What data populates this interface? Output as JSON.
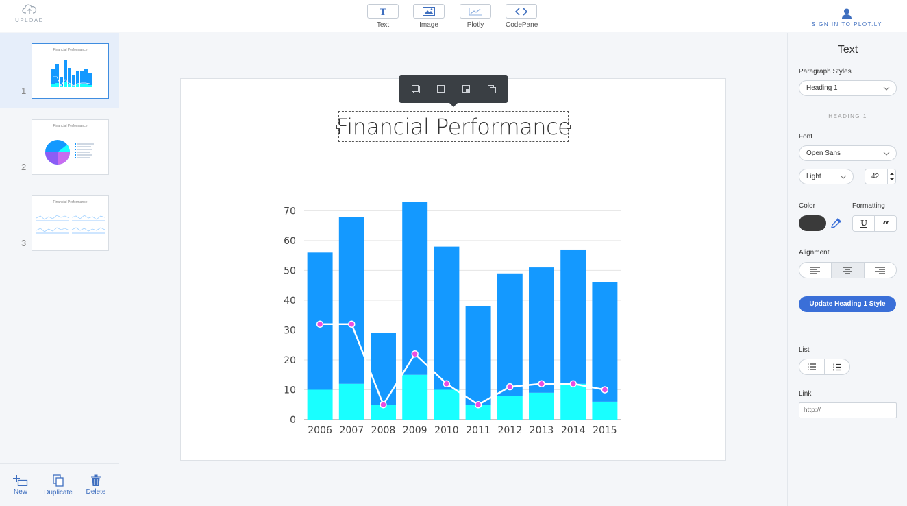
{
  "topbar": {
    "upload_label": "UPLOAD",
    "tools": [
      {
        "label": "Text",
        "icon": "text-icon"
      },
      {
        "label": "Image",
        "icon": "image-icon"
      },
      {
        "label": "Plotly",
        "icon": "plotly-chart-icon"
      },
      {
        "label": "CodePane",
        "icon": "code-icon"
      }
    ],
    "signin_label": "SIGN IN TO PLOT.LY"
  },
  "slides": {
    "items": [
      {
        "number": "1",
        "thumb_title": "Financial Performance",
        "active": true
      },
      {
        "number": "2",
        "thumb_title": "Financial Performance",
        "active": false
      },
      {
        "number": "3",
        "thumb_title": "Financial Performance",
        "active": false
      }
    ],
    "actions": {
      "new": "New",
      "duplicate": "Duplicate",
      "delete": "Delete"
    }
  },
  "canvas": {
    "title": "Financial Performance"
  },
  "chart_data": {
    "type": "bar",
    "stacked": true,
    "categories": [
      "2006",
      "2007",
      "2008",
      "2009",
      "2010",
      "2011",
      "2012",
      "2013",
      "2014",
      "2015"
    ],
    "series": [
      {
        "type": "bar",
        "color": "#19ffff",
        "values": [
          10,
          12,
          5,
          15,
          10,
          5,
          8,
          9,
          12,
          6
        ]
      },
      {
        "type": "bar",
        "color": "#1499ff",
        "values": [
          46,
          56,
          24,
          58,
          48,
          33,
          41,
          42,
          45,
          40
        ]
      },
      {
        "type": "line",
        "color": "#ffffff",
        "marker": "#e94ee0",
        "values": [
          32,
          32,
          5,
          22,
          12,
          5,
          11,
          12,
          12,
          10
        ]
      }
    ],
    "yticks": [
      "0",
      "10",
      "20",
      "30",
      "40",
      "50",
      "60",
      "70"
    ],
    "ylim": [
      0,
      74
    ],
    "grid": true,
    "title": "",
    "xlabel": "",
    "ylabel": ""
  },
  "right_panel": {
    "title": "Text",
    "paragraph_styles_label": "Paragraph Styles",
    "paragraph_style_value": "Heading 1",
    "section_header": "HEADING 1",
    "font_label": "Font",
    "font_value": "Open Sans",
    "weight_value": "Light",
    "size_value": "42",
    "color_label": "Color",
    "text_color": "#3a3a3a",
    "formatting_label": "Formatting",
    "alignment_label": "Alignment",
    "alignment_selected": "center",
    "update_button": "Update Heading 1 Style",
    "list_label": "List",
    "link_label": "Link",
    "link_placeholder": "http://"
  },
  "colors": {
    "accent": "#3a6fd8",
    "icon_blue": "#3f6fbf"
  }
}
